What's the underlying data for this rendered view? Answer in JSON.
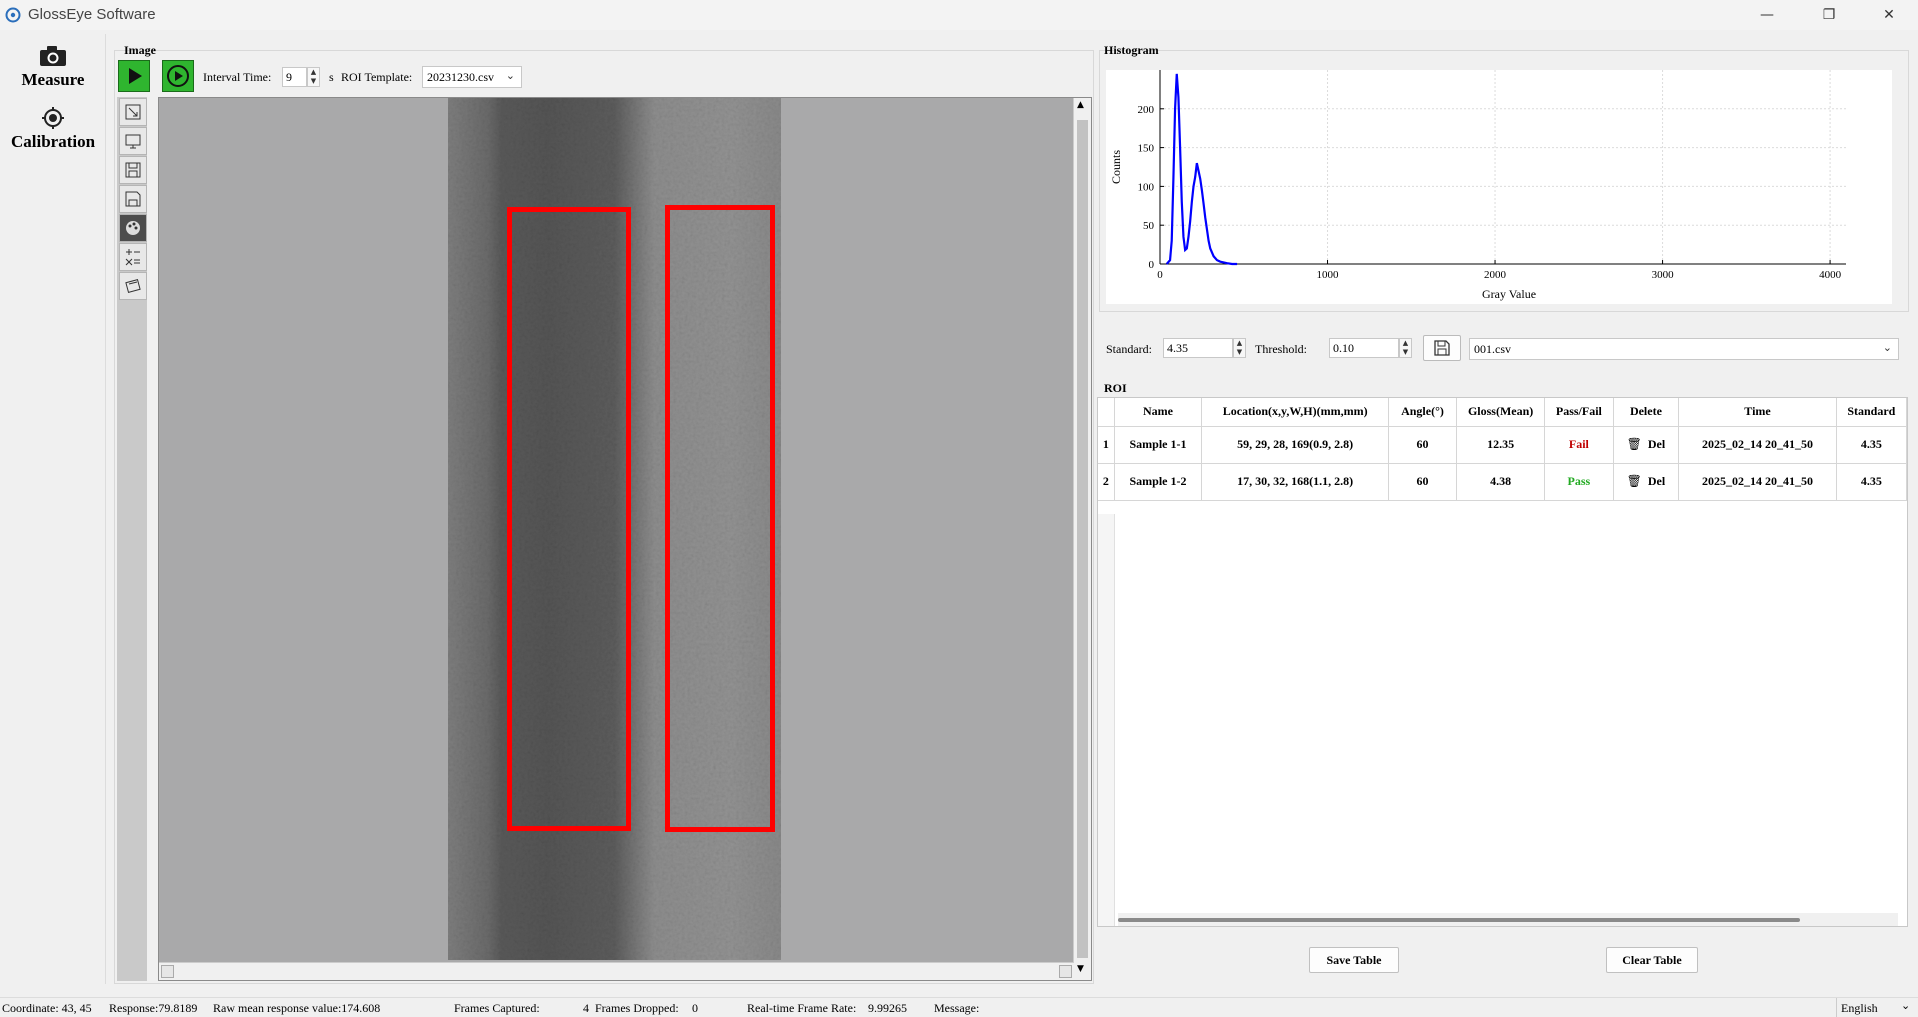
{
  "window": {
    "title": "GlossEye Software",
    "minimize": "—",
    "maximize": "❐",
    "close": "✕"
  },
  "nav": {
    "measure": "Measure",
    "calibration": "Calibration"
  },
  "image_panel": {
    "title": "Image",
    "interval_label": "Interval Time:",
    "interval_value": "9",
    "interval_unit": "s",
    "roi_template_label": "ROI Template:",
    "roi_template_value": "20231230.csv"
  },
  "histogram": {
    "title": "Histogram",
    "chart_data": {
      "type": "line",
      "xlabel": "Gray Value",
      "ylabel": "Counts",
      "xlim": [
        0,
        4095
      ],
      "ylim": [
        0,
        250
      ],
      "x_ticks": [
        "0",
        "1000",
        "2000",
        "3000",
        "4000"
      ],
      "y_ticks": [
        "0",
        "50",
        "100",
        "150",
        "200"
      ],
      "series": [
        {
          "color": "#0000ff",
          "x": [
            40,
            60,
            70,
            80,
            90,
            100,
            110,
            120,
            130,
            140,
            150,
            160,
            170,
            180,
            190,
            200,
            210,
            220,
            230,
            240,
            250,
            260,
            270,
            280,
            290,
            300,
            320,
            340,
            360,
            380,
            400,
            430,
            460
          ],
          "y": [
            0,
            5,
            30,
            110,
            200,
            245,
            215,
            150,
            80,
            35,
            18,
            20,
            35,
            55,
            80,
            100,
            112,
            130,
            120,
            110,
            95,
            78,
            60,
            45,
            30,
            20,
            10,
            5,
            3,
            2,
            1,
            0,
            0
          ]
        }
      ],
      "grid": true
    }
  },
  "controls": {
    "standard_label": "Standard:",
    "standard_value": "4.35",
    "threshold_label": "Threshold:",
    "threshold_value": "0.10",
    "file_value": "001.csv"
  },
  "roi": {
    "title": "ROI",
    "columns": [
      "Name",
      "Location(x,y,W,H)(mm,mm)",
      "Angle(°)",
      "Gloss(Mean)",
      "Pass/Fail",
      "Delete",
      "Time",
      "Standard"
    ],
    "rows": [
      {
        "num": "1",
        "name": "Sample 1-1",
        "location": "59, 29, 28, 169(0.9, 2.8)",
        "angle": "60",
        "gloss": "12.35",
        "result": "Fail",
        "delete": "Del",
        "time": "2025_02_14 20_41_50",
        "standard": "4.35"
      },
      {
        "num": "2",
        "name": "Sample 1-2",
        "location": "17, 30, 32, 168(1.1, 2.8)",
        "angle": "60",
        "gloss": "4.38",
        "result": "Pass",
        "delete": "Del",
        "time": "2025_02_14 20_41_50",
        "standard": "4.35"
      }
    ],
    "save_button": "Save Table",
    "clear_button": "Clear Table"
  },
  "status": {
    "coordinate": "Coordinate:  43, 45",
    "response": "Response:79.8189",
    "raw_mean": "Raw mean response value:174.608",
    "frames_captured_label": "Frames Captured:",
    "frames_captured": "4",
    "frames_dropped_label": "Frames Dropped:",
    "frames_dropped": "0",
    "frame_rate_label": "Real-time Frame Rate:",
    "frame_rate": "9.99265",
    "message_label": "Message:",
    "language": "English"
  }
}
